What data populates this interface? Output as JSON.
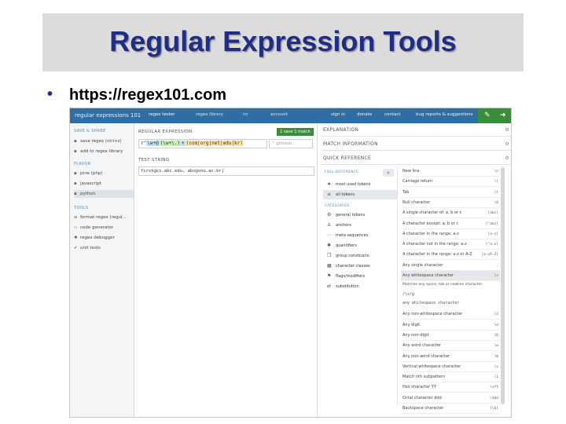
{
  "slide": {
    "title": "Regular Expression Tools",
    "bullet": "•",
    "url": "https://regex101.com"
  },
  "app": {
    "logo": "regular expressions 101",
    "nav": [
      "regex tester",
      "regex library",
      "irc",
      "account"
    ],
    "right_nav": [
      "sign in",
      "donate",
      "contact",
      "bug reports & suggestions"
    ],
    "left": {
      "save_share_label": "SAVE & SHARE",
      "save_items": [
        "save regex (ctrl+s)",
        "add to regex library"
      ],
      "flavor_label": "FLAVOR",
      "flavors": [
        "pcre (php)",
        "javascript",
        "python"
      ],
      "selected_flavor": "python",
      "tools_label": "TOOLS",
      "tools": [
        "format regex (regul...",
        "code generator",
        "regex debugger",
        "unit tests"
      ]
    },
    "middle": {
      "regex_header": "REGULAR EXPRESSION",
      "regex_delim_open": "r\"",
      "regex_tokens": [
        {
          "text": "\\w+@",
          "color": "#bfe3ff"
        },
        {
          "text": "(\\w+\\.)",
          "color": "#c7efb5"
        },
        {
          "text": "+",
          "color": "#bfe3ff"
        },
        {
          "text": "(com|org|net|edu|kr)",
          "color": "#ffe7a3"
        }
      ],
      "regex_delim_close": "\"",
      "flags": "\" gmixsu",
      "save_button": "1 save 1 match",
      "test_header": "TEST STRING",
      "test_string": "first@cs.abc.edu, abc@snu.ac.kr|"
    },
    "right": {
      "explanation": "EXPLANATION",
      "match_info": "MATCH INFORMATION",
      "quick_ref": "QUICK REFERENCE",
      "full_reference": "FULL REFERENCE",
      "top_items": [
        {
          "icon": "star",
          "label": "most used tokens"
        },
        {
          "icon": "bars",
          "label": "all tokens"
        }
      ],
      "categories_label": "CATEGORIES",
      "categories": [
        {
          "icon": "gear",
          "label": "general tokens"
        },
        {
          "icon": "anchor",
          "label": "anchors"
        },
        {
          "icon": "dots",
          "label": "meta sequences"
        },
        {
          "icon": "asterisk",
          "label": "quantifiers"
        },
        {
          "icon": "group",
          "label": "group constructs"
        },
        {
          "icon": "grid",
          "label": "character classes"
        },
        {
          "icon": "flag",
          "label": "flags/modifiers"
        },
        {
          "icon": "shuffle",
          "label": "substitution"
        }
      ],
      "tokens": [
        {
          "label": "New line",
          "token": "\\n"
        },
        {
          "label": "Carriage return",
          "token": "\\r"
        },
        {
          "label": "Tab",
          "token": "\\t"
        },
        {
          "label": "Null character",
          "token": "\\0"
        },
        {
          "label": "A single character of: a, b or c",
          "token": "[abc]"
        },
        {
          "label": "A character except: a, b or c",
          "token": "[^abc]"
        },
        {
          "label": "A character in the range: a-z",
          "token": "[a-z]"
        },
        {
          "label": "A character not in the range: a-z",
          "token": "[^a-z]"
        },
        {
          "label": "A character in the range: a-z or A-Z",
          "token": "[a-zA-Z]"
        },
        {
          "label": "Any single character",
          "token": "."
        },
        {
          "label": "Any whitespace character",
          "token": "\\s"
        }
      ],
      "detail_text": "Matches any space, tab or newline character.",
      "detail_regex": "/\\s/g",
      "detail_example": "any whitespace character",
      "tokens_after": [
        {
          "label": "Any non-whitespace character",
          "token": "\\S"
        },
        {
          "label": "Any digit",
          "token": "\\d"
        },
        {
          "label": "Any non-digit",
          "token": "\\D"
        },
        {
          "label": "Any word character",
          "token": "\\w"
        },
        {
          "label": "Any non-word character",
          "token": "\\W"
        },
        {
          "label": "Vertical whitespace character",
          "token": "\\v"
        },
        {
          "label": "Match nth subpattern",
          "token": "\\1"
        },
        {
          "label": "Hex character YY",
          "token": "\\xYY"
        },
        {
          "label": "Octal character ddd",
          "token": "\\ddd"
        },
        {
          "label": "Backspace character",
          "token": "[\\b]"
        }
      ]
    }
  }
}
